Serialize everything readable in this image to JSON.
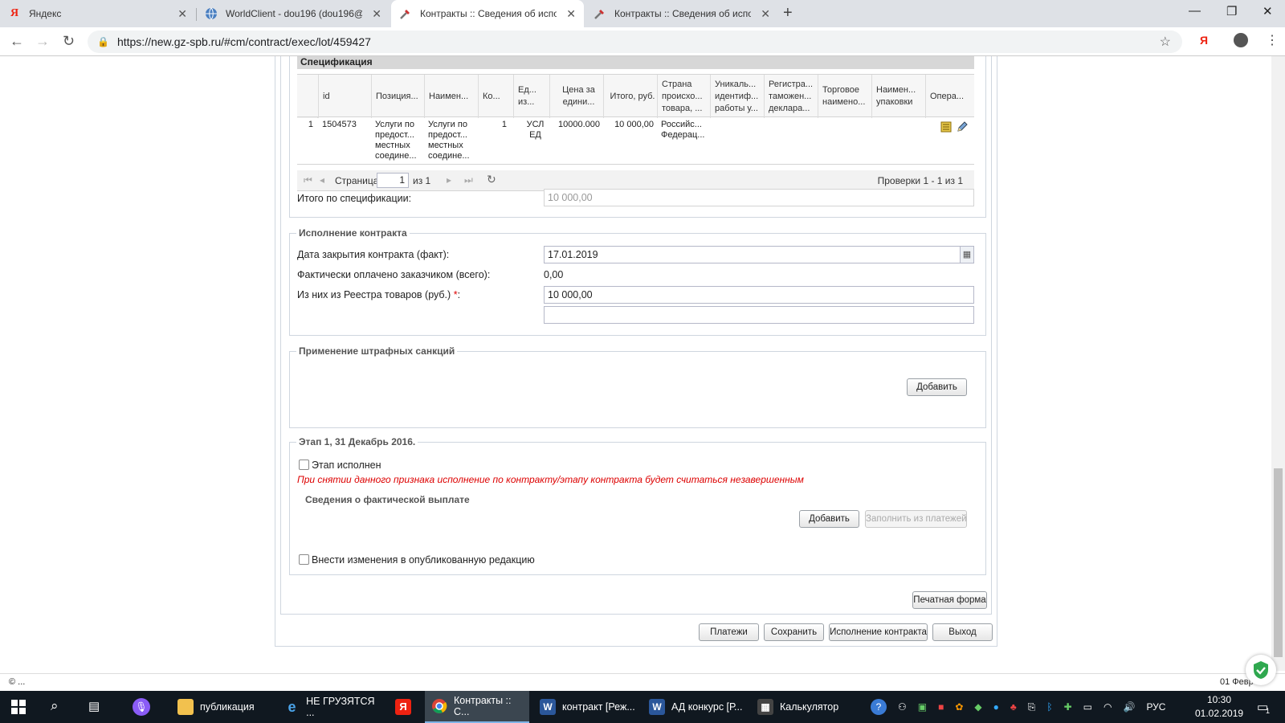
{
  "browser": {
    "tabs": [
      {
        "title": "Яндекс",
        "icon": "yandex-icon"
      },
      {
        "title": "WorldClient - dou196 (dou196@",
        "icon": "globe-icon"
      },
      {
        "title": "Контракты :: Сведения об испол",
        "icon": "tools-icon",
        "active": true
      },
      {
        "title": "Контракты :: Сведения об испол",
        "icon": "tools-icon"
      }
    ],
    "url": "https://new.gz-spb.ru/#cm/contract/exec/lot/459427",
    "ext_label": "Я"
  },
  "spec": {
    "title": "Спецификация",
    "columns": [
      "id",
      "Позиция...",
      "Наимен...",
      "Ко...",
      "Ед... из...",
      "Цена за едини...",
      "Итого, руб.",
      "Страна происхо... товара, ...",
      "Уникаль... идентиф... работы у...",
      "Регистра... таможен... деклара...",
      "Торговое наимено...",
      "Наимен... упаковки",
      "Опера..."
    ],
    "rows": [
      {
        "num": "1",
        "id": "1504573",
        "position": "Услуги по предост... местных соедине...",
        "name": "Услуги по предост... местных соедине...",
        "qty": "1",
        "unit": "УСЛ ЕД",
        "price": "10000.000",
        "total": "10 000,00",
        "country": "Российс... Федерац..."
      }
    ],
    "pager": {
      "page_label": "Страница",
      "page_value": "1",
      "of_label": "из 1",
      "summary": "Проверки 1 - 1 из 1"
    },
    "total_label": "Итого по спецификации:",
    "total_value": "10 000,00"
  },
  "execution": {
    "legend": "Исполнение контракта",
    "close_date_label": "Дата закрытия контракта (факт):",
    "close_date_value": "17.01.2019",
    "paid_label": "Фактически оплачено заказчиком (всего):",
    "paid_value": "0,00",
    "registry_label": "Из них из Реестра товаров (руб.)",
    "required_mark": "*",
    "registry_colon": ":",
    "registry_value": "10 000,00",
    "extra_value": ""
  },
  "penalties": {
    "legend": "Применение штрафных санкций",
    "add_button": "Добавить"
  },
  "stage": {
    "legend": "Этап 1, 31 Декабрь 2016.",
    "done_label": "Этап исполнен",
    "warning": "При снятии данного признака исполнение по контракту/этапу контракта будет считаться незавершенным",
    "payment_legend": "Сведения о фактической выплате",
    "add_button": "Добавить",
    "fill_button": "Заполнить из платежей",
    "edit_label": "Внести изменения в опубликованную редакцию"
  },
  "actions": {
    "print_button": "Печатная форма",
    "payments_button": "Платежи",
    "save_button": "Сохранить",
    "execution_button": "Исполнение контракта",
    "exit_button": "Выход"
  },
  "status": {
    "left": "© ...",
    "right": "01 Февр"
  },
  "taskbar": {
    "items": [
      {
        "label": "публикация",
        "icon": "folder-icon"
      },
      {
        "label": "НЕ ГРУЗЯТСЯ ...",
        "icon": "ie-icon"
      },
      {
        "label": "Контракты :: С...",
        "icon": "chrome-icon"
      },
      {
        "label": "контракт [Реж...",
        "icon": "word-icon"
      },
      {
        "label": "АД конкурс [Р...",
        "icon": "word-icon"
      },
      {
        "label": "Калькулятор",
        "icon": "calculator-icon"
      }
    ],
    "lang": "РУС",
    "time": "10:30",
    "date": "01.02.2019",
    "notif_count": "1"
  },
  "colors": {
    "accent": "#7fb3e6",
    "required": "#d00000",
    "taskbar": "#101820"
  }
}
